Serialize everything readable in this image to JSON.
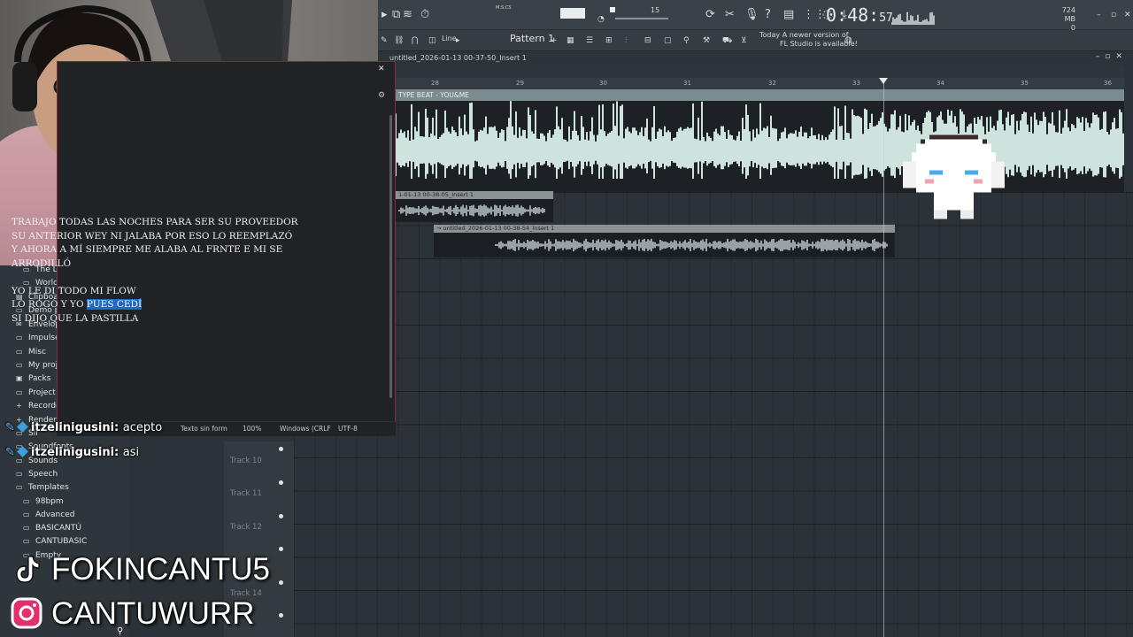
{
  "toolbar": {
    "time_main": "0:48:",
    "time_sub": "57",
    "time_unit": "M:S:CS",
    "memory": "724 MB",
    "memory_sub": "0",
    "poly": "15",
    "line_mode": "Line",
    "pattern": "Pattern 1",
    "news_date": "Today",
    "news_text_1": "A newer version of",
    "news_text_2": "FL Studio is available!"
  },
  "playlist": {
    "title": "untitled_2026-01-13 00-37-50_Insert 1",
    "clip_header": "TYPE BEAT - YOU&ME",
    "ruler_ticks": [
      "28",
      "29",
      "30",
      "31",
      "32",
      "33",
      "34",
      "35",
      "36"
    ],
    "clips": [
      {
        "label": "1-01-13 00-38-05_Insert 1"
      },
      {
        "label": "→ untitled_2026-01-13 00-38-54_Insert 1"
      }
    ],
    "tracks": [
      "Track 10",
      "Track 11",
      "Track 12",
      "Track 14"
    ]
  },
  "browser": {
    "items": [
      {
        "label": "The Lu",
        "icon": "folder-icon"
      },
      {
        "label": "Worldv",
        "icon": "folder-icon"
      },
      {
        "label": "Clipboar",
        "icon": "clipboard-icon"
      },
      {
        "label": "Demo pr",
        "icon": "folder-icon"
      },
      {
        "label": "Envelope",
        "icon": "envelope-icon"
      },
      {
        "label": "Impulses",
        "icon": "folder-icon"
      },
      {
        "label": "Misc",
        "icon": "folder-icon"
      },
      {
        "label": "My proje",
        "icon": "folder-icon"
      },
      {
        "label": "Packs",
        "icon": "packs-icon"
      },
      {
        "label": "Project b",
        "icon": "folder-icon"
      },
      {
        "label": "Recorded",
        "icon": "plus-icon"
      },
      {
        "label": "Rendered",
        "icon": "plus-icon"
      },
      {
        "label": "Sli",
        "icon": "folder-icon"
      },
      {
        "label": "Soundfonts",
        "icon": "folder-icon"
      },
      {
        "label": "Sounds",
        "icon": "folder-icon"
      },
      {
        "label": "Speech",
        "icon": "folder-icon"
      },
      {
        "label": "Templates",
        "icon": "folder-icon"
      },
      {
        "label": "98bpm",
        "icon": "folder-icon"
      },
      {
        "label": "Advanced",
        "icon": "folder-icon"
      },
      {
        "label": "BASICANTÚ",
        "icon": "folder-icon"
      },
      {
        "label": "CANTUBASIC",
        "icon": "folder-icon"
      },
      {
        "label": "Empty",
        "icon": "folder-icon"
      }
    ]
  },
  "notepad": {
    "lines": [
      "TRABAJO TODAS LAS NOCHES PARA SER SU PROVEEDOR",
      "SU ANTERIOR WEY NI JALABA POR ESO LO REEMPLAZÓ",
      "Y AHORA A MÍ SIEMPRE ME ALABA AL FRNTE E MI SE",
      "ARRODILLÓ",
      "",
      "YO LE DI TODO MI FLOW",
      "LO ROGÓ Y YO ",
      "SI DIJO QUE LA PASTILLA"
    ],
    "selected_text": "PUES CEDÍ",
    "status": {
      "format": "Texto sin form",
      "zoom": "100%",
      "line_ending": "Windows (CRLF",
      "encoding": "UTF-8"
    }
  },
  "chat": [
    {
      "user": "itzelinigusini:",
      "message": "acepto"
    },
    {
      "user": "itzelinigusini:",
      "message": "asi"
    }
  ],
  "socials": [
    {
      "platform_icon": "tiktok-icon",
      "handle": "FOKINCANTU5"
    },
    {
      "platform_icon": "instagram-icon",
      "handle": "CANTUWURR"
    }
  ],
  "colors": {
    "waveform": "#cfe3de",
    "clip_header": "#7a8c8d",
    "selection": "#1e6bc4",
    "notepad_border": "#8a2a2f",
    "chat_user": "#ffffff"
  }
}
